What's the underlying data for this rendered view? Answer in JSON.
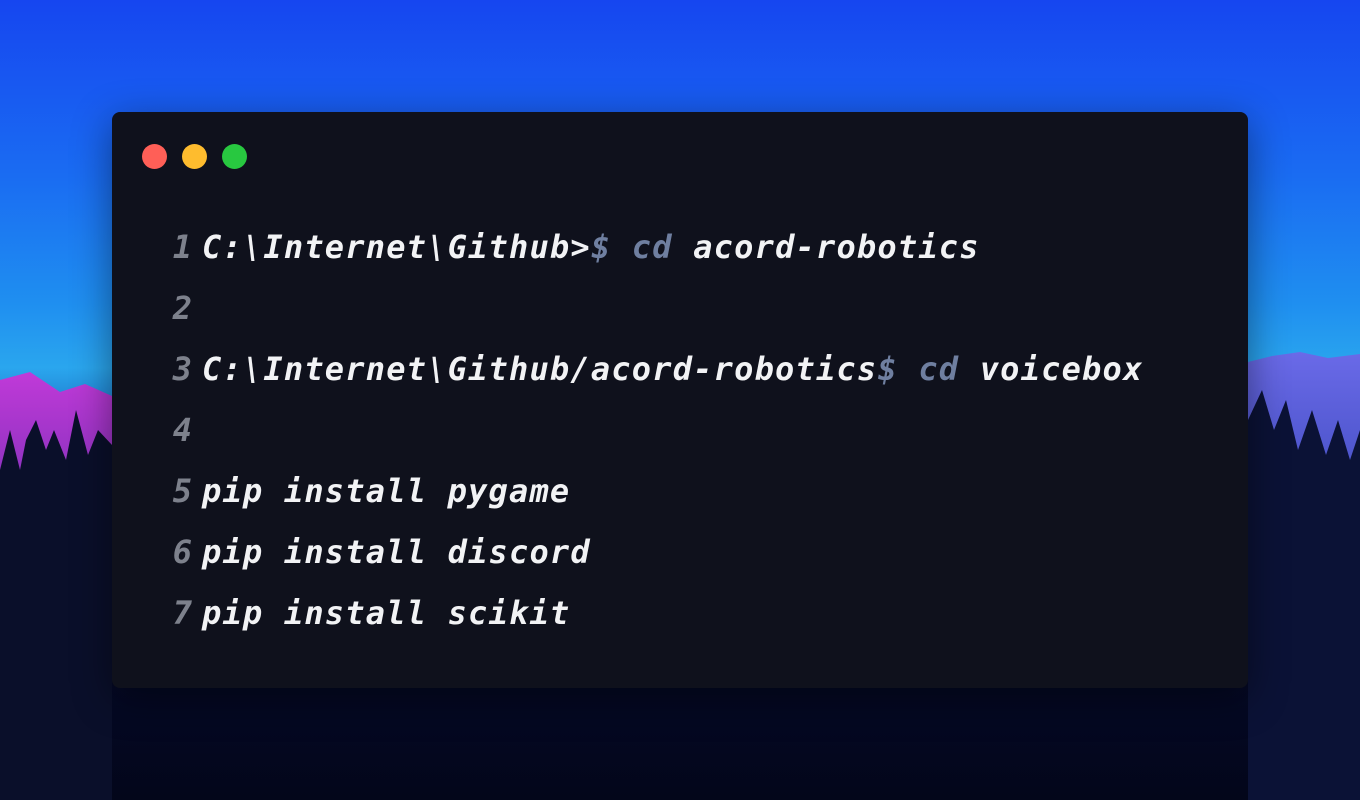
{
  "theme": {
    "window_bg": "#0f111c",
    "line_number_color": "#7d818c",
    "text_color": "#f2f3f5",
    "keyword_color": "#6f7fa0",
    "close_color": "#ff5f57",
    "minimize_color": "#febc2e",
    "maximize_color": "#28c840"
  },
  "window_controls": [
    "close-icon",
    "minimize-icon",
    "maximize-icon"
  ],
  "lines": [
    {
      "number": "1",
      "path": "C:\\Internet\\Github>",
      "prompt": "$",
      "keyword": "cd",
      "argument": "acord-robotics"
    },
    {
      "number": "2"
    },
    {
      "number": "3",
      "path": "C:\\Internet\\Github/acord-robotics",
      "prompt": "$",
      "keyword": "cd",
      "argument": "voicebox"
    },
    {
      "number": "4"
    },
    {
      "number": "5",
      "command": "pip install pygame"
    },
    {
      "number": "6",
      "command": "pip install discord"
    },
    {
      "number": "7",
      "command": "pip install scikit"
    }
  ]
}
